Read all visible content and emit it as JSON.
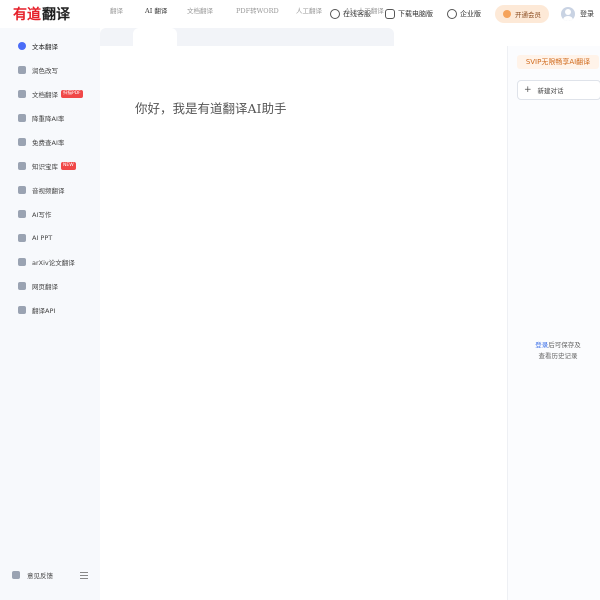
{
  "header": {
    "logo_part1": "有道",
    "logo_part2": "翻译",
    "links": [
      {
        "label": "在线客服",
        "icon": "headset-icon"
      },
      {
        "label": "下载电脑版",
        "icon": "download-icon"
      },
      {
        "label": "企业版",
        "icon": "enterprise-icon"
      }
    ],
    "vip_button": "开通会员",
    "login": "登录"
  },
  "sidebar": {
    "items": [
      {
        "label": "文本翻译",
        "icon": "text-translate-icon",
        "active": true
      },
      {
        "label": "润色改写",
        "icon": "wand-icon"
      },
      {
        "label": "文档翻译",
        "icon": "document-icon",
        "tag": "扫描PDF"
      },
      {
        "label": "降重降AI率",
        "icon": "reduce-icon"
      },
      {
        "label": "免费查AI率",
        "icon": "check-icon"
      },
      {
        "label": "知识宝库",
        "icon": "knowledge-icon",
        "tag": "NEW"
      },
      {
        "label": "音视频翻译",
        "icon": "video-icon"
      },
      {
        "label": "AI写作",
        "icon": "pen-icon"
      },
      {
        "label": "AI PPT",
        "icon": "ppt-icon"
      },
      {
        "label": "arXiv论文翻译",
        "icon": "paper-icon"
      },
      {
        "label": "网页翻译",
        "icon": "webpage-icon"
      },
      {
        "label": "翻译API",
        "icon": "cloud-icon"
      }
    ],
    "feedback": "意见反馈"
  },
  "tabs": [
    {
      "label": "翻译"
    },
    {
      "label": "AI 翻译",
      "active": true
    },
    {
      "label": "文档翻译"
    },
    {
      "label": "PDF转WORD"
    },
    {
      "label": "人工翻译"
    },
    {
      "label": "AI+人工翻译"
    }
  ],
  "main": {
    "greeting": "你好，我是有道翻译AI助手"
  },
  "right_panel": {
    "svip_banner": "SVIP无限畅享AI翻译",
    "new_chat": "新建对话",
    "login_link": "登录",
    "login_hint_rest": "后可保存及",
    "login_hint_line2": "查看历史记录"
  },
  "colors": {
    "brand_red": "#e6202a",
    "accent_blue": "#4a6cf7",
    "vip_orange": "#d06a1c"
  }
}
